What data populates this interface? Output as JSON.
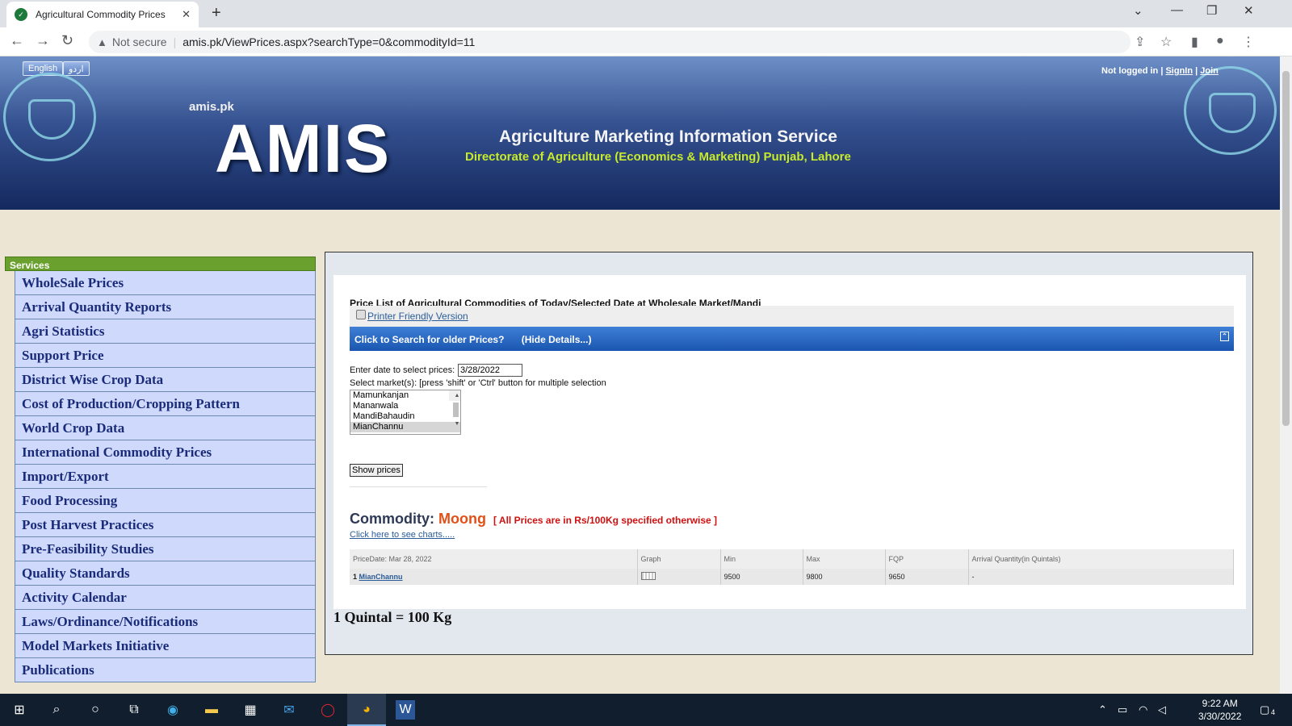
{
  "browser": {
    "tab_title": "Agricultural Commodity Prices",
    "tab_close": "✕",
    "new_tab": "+",
    "not_secure": "Not secure",
    "url": "amis.pk/ViewPrices.aspx?searchType=0&commodityId=11"
  },
  "header": {
    "lang_english": "English",
    "lang_urdu": "اردو",
    "domain": "amis.pk",
    "logo": "AMIS",
    "full_name": "Agriculture Marketing Information Service",
    "directorate": "Directorate of Agriculture (Economics & Marketing) Punjab, Lahore",
    "not_logged_in": "Not logged in",
    "sign_in": "SignIn",
    "join": "Join"
  },
  "sidebar": {
    "heading": "Services",
    "items": [
      {
        "label": "WholeSale Prices"
      },
      {
        "label": "Arrival Quantity Reports"
      },
      {
        "label": "Agri Statistics"
      },
      {
        "label": "Support Price"
      },
      {
        "label": "District Wise Crop Data"
      },
      {
        "label": "Cost of Production/Cropping Pattern"
      },
      {
        "label": "World Crop Data"
      },
      {
        "label": "International Commodity Prices"
      },
      {
        "label": "Import/Export"
      },
      {
        "label": "Food Processing"
      },
      {
        "label": "Post Harvest Practices"
      },
      {
        "label": "Pre-Feasibility Studies"
      },
      {
        "label": "Quality Standards"
      },
      {
        "label": "Activity Calendar"
      },
      {
        "label": "Laws/Ordinance/Notifications"
      },
      {
        "label": "Model Markets Initiative"
      },
      {
        "label": "Publications"
      }
    ]
  },
  "main": {
    "title": "Price List of Agricultural Commodities of Today/Selected Date at Wholesale Market/Mandi",
    "printer_link": "Printer Friendly Version",
    "search_older": "Click to Search for older Prices?",
    "hide_details": "(Hide Details...)",
    "date_label": "Enter date to select prices:",
    "date_value": "3/28/2022",
    "market_label": "Select market(s): [press 'shift' or 'Ctrl' button for multiple selection",
    "markets": [
      "Mamunkanjan",
      "Mananwala",
      "MandiBahaudin",
      "MianChannu"
    ],
    "selected_market": "MianChannu",
    "show_prices": "Show prices",
    "commodity_label": "Commodity:",
    "commodity_name": "Moong",
    "price_note": "[ All Prices are in Rs/100Kg specified otherwise ]",
    "charts_link": "Click here to see charts.....",
    "table": {
      "headers": [
        "PriceDate: Mar 28, 2022",
        "Graph",
        "Min",
        "Max",
        "FQP",
        "Arrival Quantity(in Quintals)"
      ],
      "rows": [
        {
          "index": "1",
          "market": "MianChannu",
          "min": "9500",
          "max": "9800",
          "fqp": "9650",
          "arrival": "-"
        }
      ]
    },
    "quintal_note": "1 Quintal = 100 Kg"
  },
  "taskbar": {
    "time": "9:22 AM",
    "date": "3/30/2022",
    "notifications": "4"
  }
}
